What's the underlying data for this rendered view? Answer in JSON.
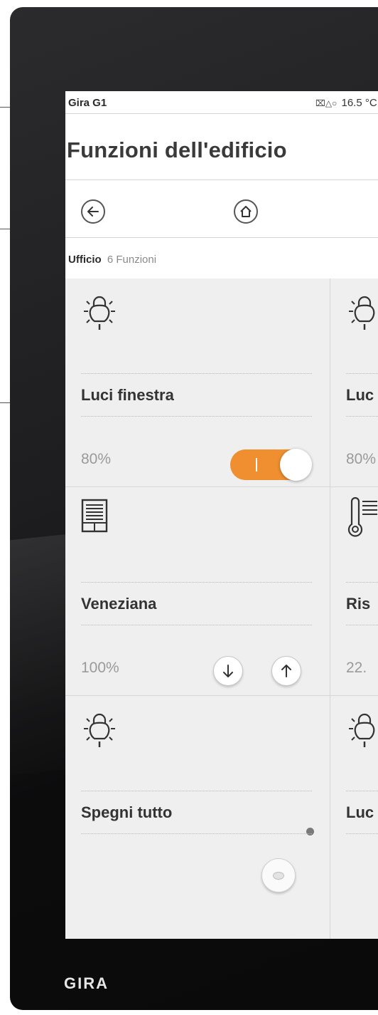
{
  "device": {
    "brand": "GIRA"
  },
  "status_bar": {
    "device_name": "Gira G1",
    "temperature": "16.5 °C"
  },
  "page": {
    "title": "Funzioni dell'edificio"
  },
  "navigation": {
    "back_icon": "arrow-left-icon",
    "home_icon": "home-icon"
  },
  "room": {
    "name": "Ufficio",
    "function_count": "6 Funzioni"
  },
  "tiles": [
    {
      "icon": "bulb-icon",
      "title": "Luci finestra",
      "value": "80%",
      "control": "toggle",
      "toggle_on": true,
      "accent": "#ef8f2f"
    },
    {
      "icon": "bulb-icon",
      "title": "Luc",
      "value": "80%",
      "control": "partial"
    },
    {
      "icon": "blind-icon",
      "title": "Veneziana",
      "value": "100%",
      "control": "up-down"
    },
    {
      "icon": "thermometer-icon",
      "title": "Ris",
      "value": "22.",
      "control": "partial"
    },
    {
      "icon": "bulb-icon",
      "title": "Spegni tutto",
      "value": "",
      "control": "push-button"
    },
    {
      "icon": "bulb-icon",
      "title": "Luc",
      "value": "",
      "control": "partial"
    }
  ],
  "pagination": {
    "current": 1,
    "indicator_color": "#b8d04a"
  }
}
